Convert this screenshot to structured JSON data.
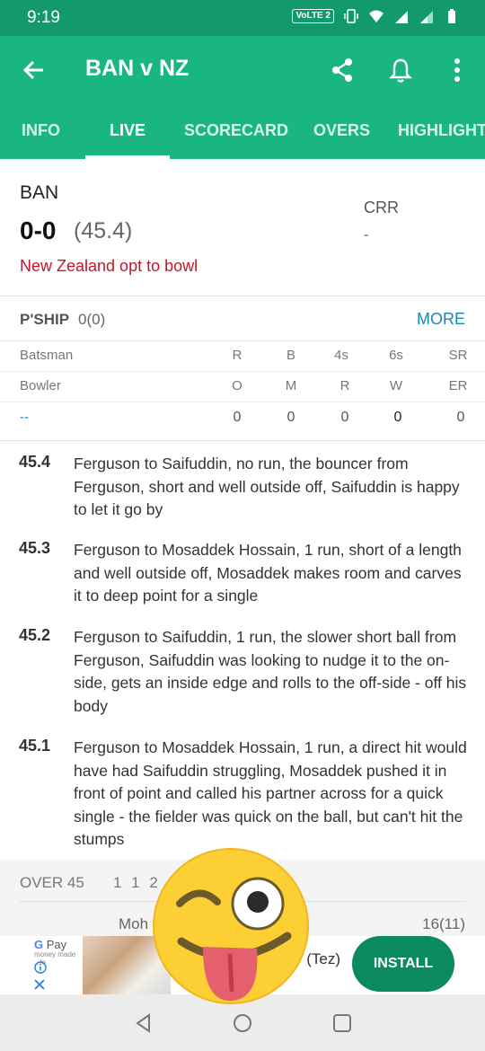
{
  "status_bar": {
    "time": "9:19",
    "network_badge": "VoLTE 2",
    "icons": [
      "vibrate-icon",
      "wifi-icon",
      "signal-icon",
      "signal-2-icon",
      "battery-icon"
    ]
  },
  "app_bar": {
    "title": "BAN v NZ",
    "actions": [
      "share-icon",
      "bell-icon",
      "more-vert-icon"
    ]
  },
  "tabs": [
    {
      "label": "INFO",
      "active": false
    },
    {
      "label": "LIVE",
      "active": true
    },
    {
      "label": "SCORECARD",
      "active": false
    },
    {
      "label": "OVERS",
      "active": false
    },
    {
      "label": "HIGHLIGHT",
      "active": false
    }
  ],
  "score": {
    "team": "BAN",
    "runs": "0-0",
    "overs": "(45.4)",
    "toss": "New Zealand opt to bowl",
    "crr_label": "CRR",
    "crr_value": "-"
  },
  "partnership": {
    "label": "P'SHIP",
    "value": "0(0)",
    "more": "MORE"
  },
  "batsman_header": [
    "Batsman",
    "R",
    "B",
    "4s",
    "6s",
    "SR"
  ],
  "bowler_header": [
    "Bowler",
    "O",
    "M",
    "R",
    "W",
    "ER"
  ],
  "bowler_row": [
    "--",
    "0",
    "0",
    "0",
    "0",
    "0"
  ],
  "commentary": [
    {
      "over": "45.4",
      "text": "Ferguson to Saifuddin, no run, the bouncer from Ferguson, short and well outside off, Saifuddin is happy to let it go by"
    },
    {
      "over": "45.3",
      "text": "Ferguson to Mosaddek Hossain, 1 run, short of a length and well outside off, Mosaddek makes room and carves it to deep point for a single"
    },
    {
      "over": "45.2",
      "text": "Ferguson to Saifuddin, 1 run, the slower short ball from Ferguson, Saifuddin was looking to nudge it to the on-side, gets an inside edge and rolls to the off-side - off his body"
    },
    {
      "over": "45.1",
      "text": "Ferguson to Mosaddek Hossain, 1 run, a direct hit would have had Saifuddin struggling, Mosaddek pushed it in front of point and called his partner across for a quick single - the fielder was quick on the ball, but can't hit the stumps"
    }
  ],
  "over_summary": {
    "label": "OVER 45",
    "balls": "1 1 2 0",
    "batsman": "Moh",
    "batsman_figures": "16(11)"
  },
  "ad": {
    "brand": "Pay",
    "brand_g": "G",
    "tagline": "money made ...le",
    "app_name": "y (Tez)",
    "install_label": "INSTALL"
  },
  "nav": [
    "back-nav-icon",
    "home-nav-icon",
    "recents-nav-icon"
  ],
  "colors": {
    "status_bar": "#129a6e",
    "app_bar": "#19b583",
    "toss_text": "#c4162a",
    "more_link": "#1a88b4",
    "install_button": "#0b8a5f"
  }
}
